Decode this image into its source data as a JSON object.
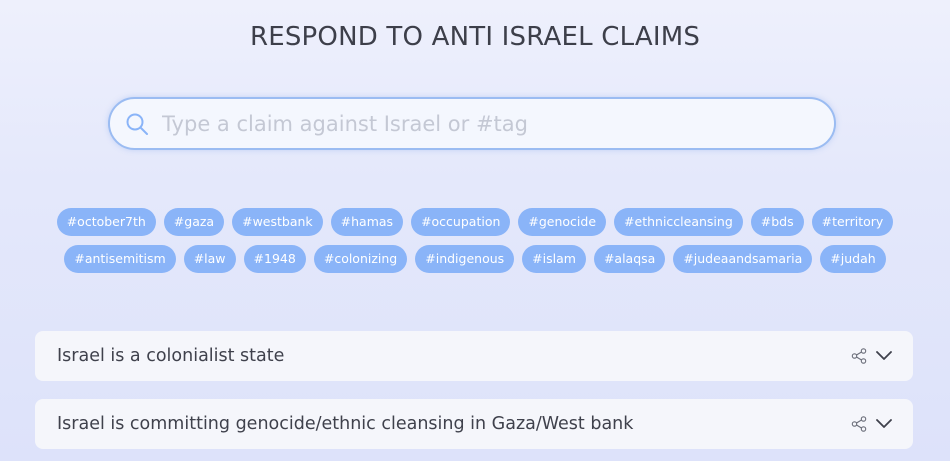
{
  "header": {
    "title": "RESPOND TO ANTI ISRAEL CLAIMS"
  },
  "search": {
    "placeholder": "Type a claim against Israel or #tag",
    "value": "",
    "icon": "search-icon"
  },
  "tags": {
    "row1": [
      "#october7th",
      "#gaza",
      "#westbank",
      "#hamas",
      "#occupation",
      "#genocide",
      "#ethniccleansing",
      "#bds",
      "#territory"
    ],
    "row2": [
      "#antisemitism",
      "#law",
      "#1948",
      "#colonizing",
      "#indigenous",
      "#islam",
      "#alaqsa",
      "#judeaandsamaria",
      "#judah"
    ]
  },
  "claims": [
    {
      "text": "Israel is a colonialist state",
      "icons": [
        "share-icon",
        "chevron-down-icon"
      ]
    },
    {
      "text": "Israel is committing genocide/ethnic cleansing in Gaza/West bank",
      "icons": [
        "share-icon",
        "chevron-down-icon"
      ]
    }
  ],
  "colors": {
    "tag_background": "#8ab4f8",
    "tag_text": "#ffffff",
    "search_border": "#9bbcf2",
    "title_text": "#3d3f4a",
    "card_background": "#f5f6fb"
  }
}
